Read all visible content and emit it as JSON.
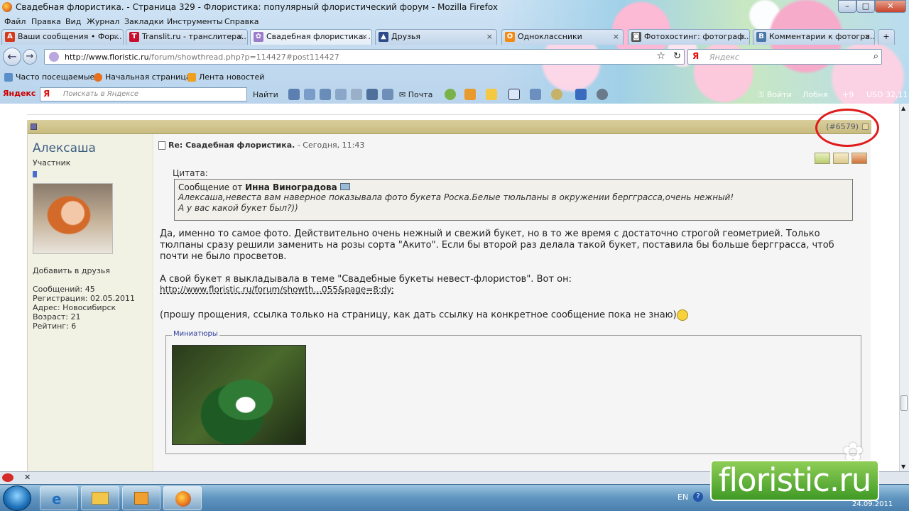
{
  "window": {
    "title": "Свадебная флористика. - Страница 329 - Флористика: популярный флористический форум - Mozilla Firefox"
  },
  "menubar": [
    "Файл",
    "Правка",
    "Вид",
    "Журнал",
    "Закладки",
    "Инструменты",
    "Справка"
  ],
  "tabs": [
    {
      "label": "Ваши сообщения • Фор...",
      "icon": "A",
      "color": "#d63a1c"
    },
    {
      "label": "Translit.ru - транслитера...",
      "icon": "T",
      "color": "#c8102e"
    },
    {
      "label": "Свадебная флористика. ...",
      "icon": "✿",
      "color": "#9b7cc9"
    },
    {
      "label": "Друзья",
      "icon": "▲",
      "color": "#2e4a88"
    },
    {
      "label": "Одноклассники",
      "icon": "O",
      "color": "#f28a14"
    },
    {
      "label": "Фотохостинг: фотограф...",
      "icon": "◙",
      "color": "#555555"
    },
    {
      "label": "Комментарии к фотогра...",
      "icon": "B",
      "color": "#4a76a8"
    }
  ],
  "nav": {
    "url_host": "http://www.floristic.ru",
    "url_path": "/forum/showthread.php?p=114427#post114427",
    "search_placeholder": "Яндекс"
  },
  "bookmarks": [
    "Часто посещаемые",
    "Начальная страница",
    "Лента новостей"
  ],
  "yandex_bar": {
    "brand": "Яндекс",
    "search_placeholder": "Поискать в Яндексе",
    "find": "Найти",
    "mail": "Почта",
    "login": "Войти",
    "city": "Лобня",
    "temp": "+9",
    "currency": "USD 32,11"
  },
  "post": {
    "number": "(#6579)",
    "user": {
      "name": "Алексаша",
      "title": "Участник",
      "add_friend": "Добавить в друзья",
      "messages": "Сообщений: 45",
      "registered": "Регистрация: 02.05.2011",
      "address": "Адрес: Новосибирск",
      "age": "Возраст: 21",
      "rating": "Рейтинг: 6"
    },
    "title": "Re: Свадебная флористика.",
    "date": " - Сегодня, 11:43",
    "quote": {
      "label": "Цитата:",
      "from_prefix": "Сообщение от ",
      "from_name": "Инна Виноградова",
      "line1": "Алексаша,невеста вам наверное показывала фото букета Роска.Белые тюльпаны в окружении бергграсса,очень нежный!",
      "line2": "А у вас какой букет был?))"
    },
    "para1": "Да, именно то самое фото. Действительно очень нежный и свежий букет, но в то же время с достаточно строгой геометрией. Только тюлпаны сразу решили заменить на розы сорта \"Акито\". Если бы второй раз делала такой букет, поставила бы больше бергграсса, чтоб почти не было просветов.",
    "para2": "А свой букет я выкладывала в теме \"Свадебные букеты невест-флористов\". Вот он:",
    "link": "http://www.floristic.ru/forum/showth...055&page=8:dy:",
    "para3": "(прошу прощения, ссылка только на страницу, как дать ссылку на конкретное сообщение пока не знаю)",
    "thumbs_label": "Миниатюры"
  },
  "taskbar": {
    "lang": "EN",
    "date": "24.09.2011"
  },
  "watermark": "floristic.ru"
}
